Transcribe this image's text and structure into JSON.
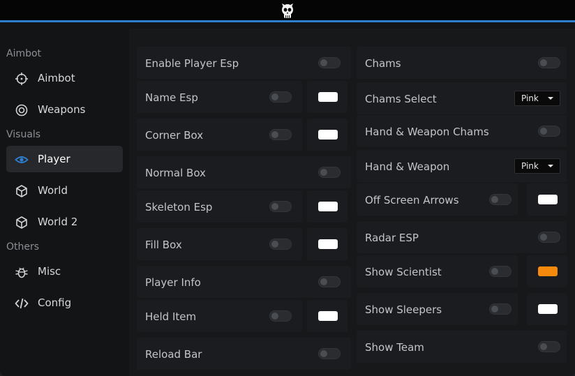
{
  "sidebar": {
    "sections": [
      {
        "label": "Aimbot"
      },
      {
        "label": "Visuals"
      },
      {
        "label": "Others"
      }
    ],
    "items": [
      {
        "label": "Aimbot",
        "icon": "crosshair-icon",
        "active": false
      },
      {
        "label": "Weapons",
        "icon": "target-icon",
        "active": false
      },
      {
        "label": "Player",
        "icon": "eye-icon",
        "active": true
      },
      {
        "label": "World",
        "icon": "cube-icon",
        "active": false
      },
      {
        "label": "World 2",
        "icon": "cube-icon",
        "active": false
      },
      {
        "label": "Misc",
        "icon": "bug-icon",
        "active": false
      },
      {
        "label": "Config",
        "icon": "code-icon",
        "active": false
      }
    ]
  },
  "left_column": [
    {
      "label": "Enable Player Esp",
      "enabled": false
    },
    {
      "label": "Name Esp",
      "enabled": false,
      "color": "#ffffff"
    },
    {
      "label": "Corner Box",
      "enabled": false,
      "color": "#ffffff"
    },
    {
      "label": "Normal Box",
      "enabled": false
    },
    {
      "label": "Skeleton Esp",
      "enabled": false,
      "color": "#ffffff"
    },
    {
      "label": "Fill Box",
      "enabled": false,
      "color": "#ffffff"
    },
    {
      "label": "Player Info",
      "enabled": false
    },
    {
      "label": "Held Item",
      "enabled": false,
      "color": "#ffffff"
    },
    {
      "label": "Reload Bar",
      "enabled": false
    }
  ],
  "right_column": [
    {
      "label": "Chams",
      "enabled": false
    },
    {
      "label": "Chams Select",
      "dropdown": "Pink"
    },
    {
      "label": "Hand & Weapon Chams",
      "enabled": false
    },
    {
      "label": "Hand & Weapon",
      "dropdown": "Pink"
    },
    {
      "label": "Off Screen Arrows",
      "enabled": false,
      "color": "#ffffff"
    },
    {
      "label": "Radar ESP",
      "enabled": false
    },
    {
      "label": "Show Scientist",
      "enabled": false,
      "color": "#f58a0d"
    },
    {
      "label": "Show Sleepers",
      "enabled": false,
      "color": "#ffffff"
    },
    {
      "label": "Show Team",
      "enabled": false
    }
  ],
  "colors": {
    "accent": "#2f7fd0",
    "background": "#131416",
    "card": "#1b1c1f"
  }
}
